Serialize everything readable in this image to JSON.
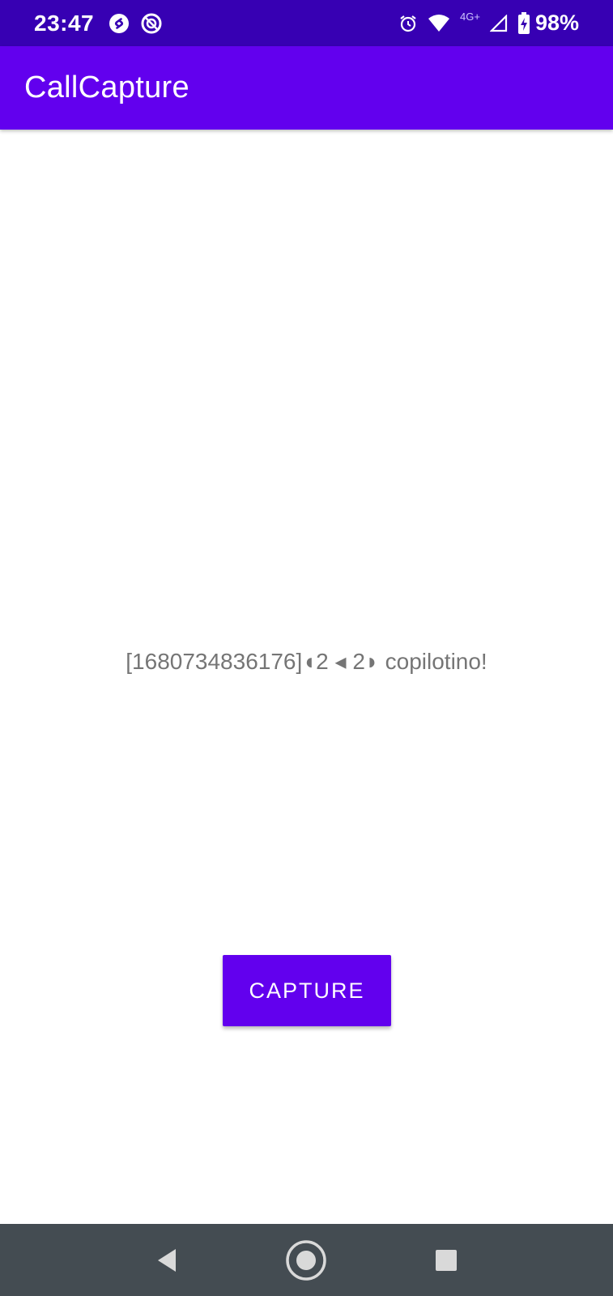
{
  "status_bar": {
    "time": "23:47",
    "left_icons": [
      "shazam-icon",
      "vpn-icon"
    ],
    "right_icons": [
      "alarm-icon",
      "wifi-icon",
      "cell-signal-icon",
      "battery-charging-icon"
    ],
    "network_type": "4G+",
    "battery": "98%"
  },
  "app_bar": {
    "title": "CallCapture",
    "color": "#6200ee"
  },
  "main": {
    "message": "[1680734836176]◖2 ◂ 2◗ copilotino!",
    "capture_button_label": "CAPTURE"
  },
  "nav_bar": {
    "buttons": [
      "back-icon",
      "home-icon",
      "recents-icon"
    ]
  },
  "colors": {
    "status_bar": "#3700b3",
    "primary": "#6200ee",
    "nav_bar": "#444c52",
    "message_text": "#757575"
  }
}
